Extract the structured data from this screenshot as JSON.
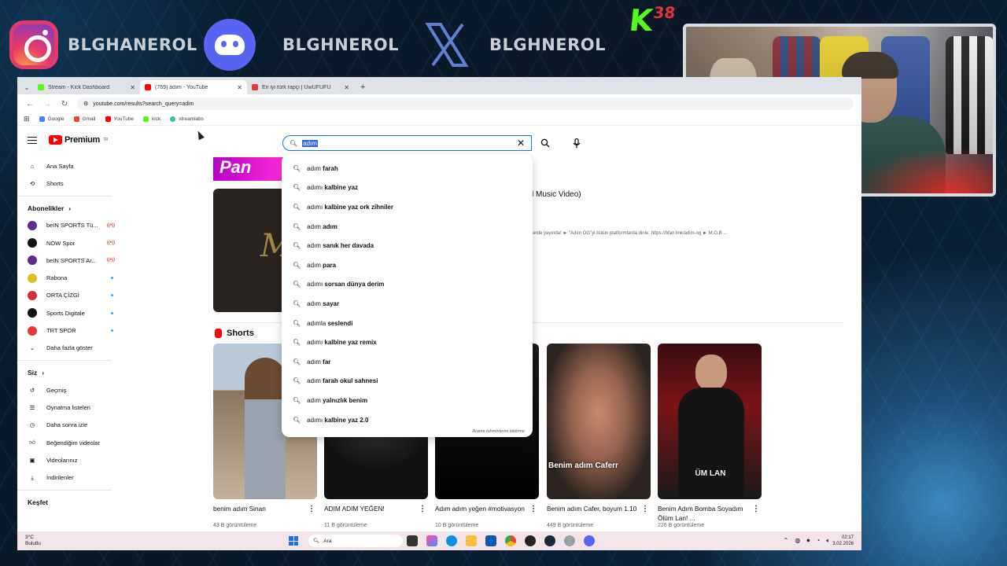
{
  "overlay": {
    "instagram_handle": "BLGHANEROL",
    "discord_handle": "BLGHNEROL",
    "x_handle": "BLGHNEROL",
    "kick_logo": "K",
    "kick_number": "38"
  },
  "browser": {
    "tabs": [
      {
        "title": "Stream - Kick Dashboard",
        "color": "#53fc18"
      },
      {
        "title": "(769) adım - YouTube",
        "color": "#ff0000"
      },
      {
        "title": "En iyi türk rapçi | UwUFUFU",
        "color": "#e53935"
      }
    ],
    "new_tab": "+",
    "url": "youtube.com/results?search_query=adim",
    "bookmarks": [
      {
        "label": "Google",
        "color": "#4285f4"
      },
      {
        "label": "Gmail",
        "color": "#ea4335"
      },
      {
        "label": "YouTube",
        "color": "#ff0000"
      },
      {
        "label": "kick",
        "color": "#53fc18"
      },
      {
        "label": "streamlabs",
        "color": "#31c3a2"
      }
    ]
  },
  "youtube": {
    "logo": "Premium",
    "logo_sup": "TR",
    "search_value": "adım",
    "sidebar": {
      "main": [
        {
          "label": "Ana Sayfa",
          "icon": "home-icon"
        },
        {
          "label": "Shorts",
          "icon": "shorts-icon"
        }
      ],
      "subscriptions_header": "Abonelikler",
      "subscriptions": [
        {
          "label": "beIN SPORTS Tü...",
          "status": "live",
          "color": "#5b2d8e"
        },
        {
          "label": "NOW Spor",
          "status": "live",
          "color": "#111111"
        },
        {
          "label": "beIN SPORTS Ar...",
          "status": "live",
          "color": "#5b2d8e"
        },
        {
          "label": "Rabona",
          "status": "new",
          "color": "#e0c020"
        },
        {
          "label": "ORTA ÇİZGİ",
          "status": "new",
          "color": "#d32f2f"
        },
        {
          "label": "Sports Digitale",
          "status": "new",
          "color": "#111111"
        },
        {
          "label": "TRT SPOR",
          "status": "new",
          "color": "#e53935"
        }
      ],
      "show_more": "Daha fazla göster",
      "you_header": "Siz",
      "you": [
        {
          "label": "Geçmiş",
          "icon": "history-icon"
        },
        {
          "label": "Oynatma listeleri",
          "icon": "playlist-icon"
        },
        {
          "label": "Daha sonra izle",
          "icon": "clock-icon"
        },
        {
          "label": "Beğendiğim videolar",
          "icon": "thumbs-up-icon"
        },
        {
          "label": "Videolarınız",
          "icon": "video-icon"
        },
        {
          "label": "İndirilenler",
          "icon": "download-icon"
        }
      ],
      "explore_header": "Keşfet"
    },
    "video_title_fragment": "l Music Video)",
    "video_desc_fragment": "lerde yayında! ► \"Adım OG\"yi bütün platformlarda dinle: https://bfan.link/adim-og ► M.O.B ...",
    "shorts_header": "Shorts",
    "shorts": [
      {
        "title": "benim adım Sinan",
        "views": "43 B görüntüleme",
        "overlay": ""
      },
      {
        "title": "ADIM ADIM YEĞEN!",
        "views": "11 B görüntüleme",
        "overlay": ""
      },
      {
        "title": "Adım adım yeğen #motivasyon",
        "views": "10 B görüntüleme",
        "overlay": ""
      },
      {
        "title": "Benim adım Cafer, boyum 1.10",
        "views": "449 B görüntüleme",
        "overlay": "Benim adım Caferr"
      },
      {
        "title": "Benim Adım Bomba Soyadım Ölüm Lan! ...",
        "views": "226 B görüntüleme",
        "overlay": "ÜM LAN"
      }
    ],
    "suggestions": [
      {
        "prefix": "adım",
        "rest": " farah"
      },
      {
        "prefix": "adımı",
        "rest": " kalbine yaz"
      },
      {
        "prefix": "adımı",
        "rest": " kalbine yaz ork zihniler"
      },
      {
        "prefix": "adım",
        "rest": " adım"
      },
      {
        "prefix": "adım",
        "rest": " sanık her davada"
      },
      {
        "prefix": "adım",
        "rest": " para"
      },
      {
        "prefix": "adımı",
        "rest": " sorsan dünya derim"
      },
      {
        "prefix": "adım",
        "rest": " sayar"
      },
      {
        "prefix": "adımla",
        "rest": " seslendi"
      },
      {
        "prefix": "adımı",
        "rest": " kalbine yaz remix"
      },
      {
        "prefix": "adım",
        "rest": " far"
      },
      {
        "prefix": "adım",
        "rest": " farah okul sahnesi"
      },
      {
        "prefix": "adım",
        "rest": " yalnızlık benim"
      },
      {
        "prefix": "adımı",
        "rest": " kalbine yaz 2.0"
      }
    ],
    "report_link": "Arama tahminlerini bildirme"
  },
  "taskbar": {
    "weather_temp": "3°C",
    "weather_desc": "Bulutlu",
    "search_placeholder": "Ara",
    "time": "02:17",
    "date": "3.02.2026"
  }
}
